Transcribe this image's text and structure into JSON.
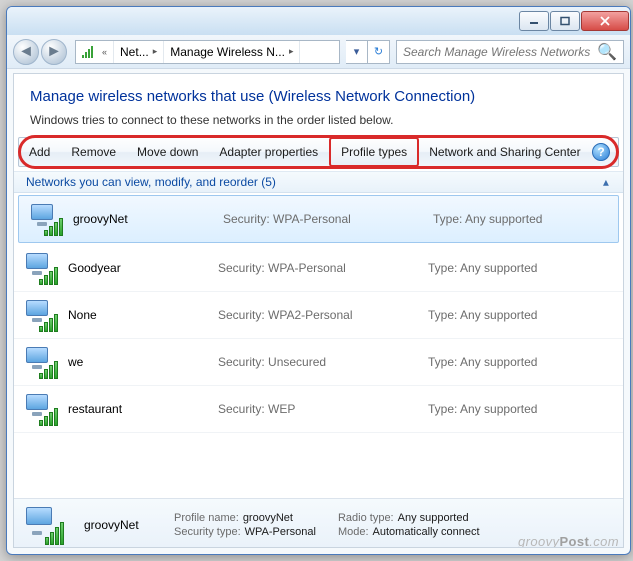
{
  "breadcrumb": {
    "seg1": "Net...",
    "seg2": "Manage Wireless N..."
  },
  "search": {
    "placeholder": "Search Manage Wireless Networks"
  },
  "header": {
    "title": "Manage wireless networks that use (Wireless Network Connection)",
    "subtitle": "Windows tries to connect to these networks in the order listed below."
  },
  "toolbar": {
    "add": "Add",
    "remove": "Remove",
    "movedown": "Move down",
    "adapter": "Adapter properties",
    "profile": "Profile types",
    "sharing": "Network and Sharing Center"
  },
  "group": {
    "label": "Networks you can view, modify, and reorder (5)"
  },
  "labels": {
    "security": "Security:",
    "type": "Type:"
  },
  "networks": [
    {
      "name": "groovyNet",
      "security": "WPA-Personal",
      "type": "Any supported",
      "selected": true
    },
    {
      "name": "Goodyear",
      "security": "WPA-Personal",
      "type": "Any supported",
      "selected": false
    },
    {
      "name": "None",
      "security": "WPA2-Personal",
      "type": "Any supported",
      "selected": false
    },
    {
      "name": "we",
      "security": "Unsecured",
      "type": "Any supported",
      "selected": false
    },
    {
      "name": "restaurant",
      "security": "WEP",
      "type": "Any supported",
      "selected": false
    }
  ],
  "details": {
    "name": "groovyNet",
    "labels": {
      "profile": "Profile name:",
      "sectype": "Security type:",
      "radio": "Radio type:",
      "mode": "Mode:"
    },
    "profile": "groovyNet",
    "sectype": "WPA-Personal",
    "radio": "Any supported",
    "mode": "Automatically connect"
  },
  "watermark": {
    "a": "groovy",
    "b": "Post",
    "c": ".com"
  }
}
